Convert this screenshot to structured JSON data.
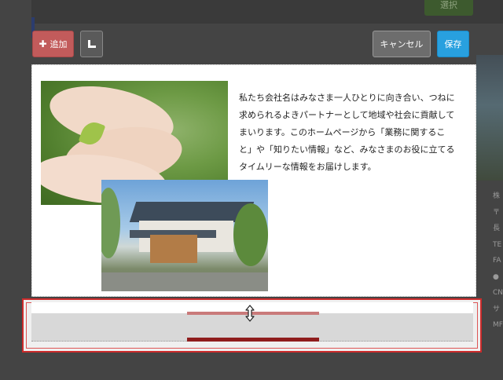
{
  "background": {
    "select_button_label": "選択",
    "faded_heading": "",
    "right_column_chars": [
      "株",
      "〒",
      "長",
      "TE",
      "FA",
      "●",
      "CN",
      "サ",
      "MF"
    ]
  },
  "toolbar": {
    "add_label": "追加",
    "add_icon": "plus-icon",
    "corner_icon": "corner-icon",
    "cancel_label": "キャンセル",
    "save_label": "保存"
  },
  "content": {
    "paragraph_lines": [
      "私たち会社名はみなさま一人ひとりに向き合い、つねに",
      "求められるよきパートナーとして地域や社会に貢献して",
      "まいります。このホームページから「業務に関するこ",
      "と」や「知りたい情報」など、みなさまのお役に立てる",
      "タイムリーな情報をお届けします。"
    ]
  },
  "resize": {
    "handle_icon": "resize-vertical-icon"
  },
  "colors": {
    "add_button": "#c25b5b",
    "save_button": "#28a0df",
    "cancel_button": "#6d6d6d",
    "highlight_border": "#cc2b2b"
  }
}
